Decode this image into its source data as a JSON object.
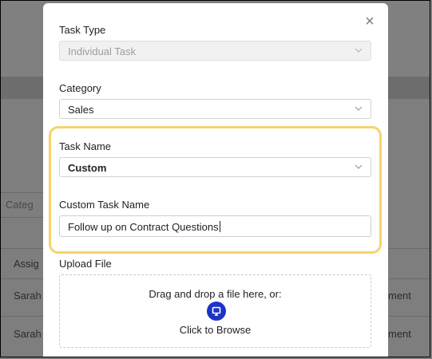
{
  "background": {
    "category_partial": "Categ",
    "column_header_partial": "Assig",
    "rows": [
      {
        "assignee_partial": "Sarah",
        "right_partial": "ment"
      },
      {
        "assignee_partial": "Sarah",
        "right_partial": "ment"
      }
    ]
  },
  "modal": {
    "close_icon": "×",
    "task_type": {
      "label": "Task Type",
      "value": "Individual Task"
    },
    "category": {
      "label": "Category",
      "value": "Sales"
    },
    "task_name": {
      "label": "Task Name",
      "value": "Custom"
    },
    "custom_task_name": {
      "label": "Custom Task Name",
      "value": "Follow up on Contract Questions"
    },
    "upload": {
      "label": "Upload File",
      "drag_text": "Drag and drop a file here, or:",
      "browse_text": "Click to Browse",
      "icon": "monitor-icon"
    }
  },
  "colors": {
    "highlight": "#f8d36a",
    "upload_button": "#1d33c8"
  }
}
